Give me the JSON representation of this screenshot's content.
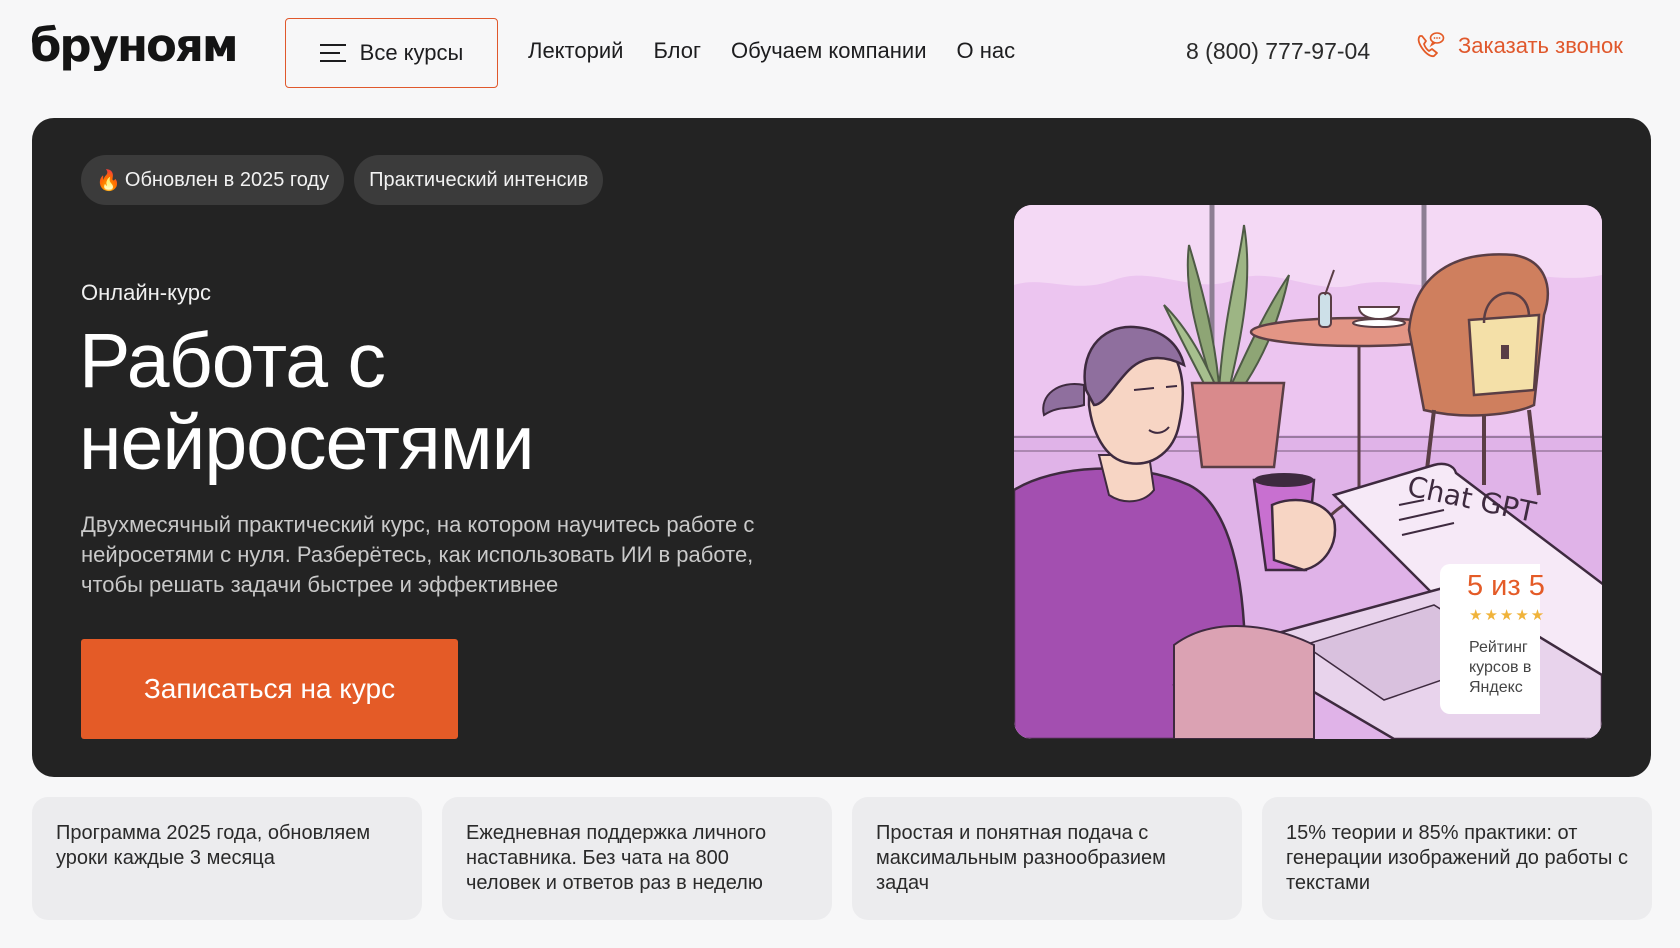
{
  "header": {
    "logo": "бруноям",
    "all_courses_label": "Все курсы",
    "nav": [
      "Лекторий",
      "Блог",
      "Обучаем компании",
      "О нас"
    ],
    "phone": "8 (800) 777-97-04",
    "callback_label": "Заказать звонок"
  },
  "hero": {
    "badges": [
      "Обновлен в 2025 году",
      "Практический интенсив"
    ],
    "kicker": "Онлайн-курс",
    "title": "Работа с нейросетями",
    "description": "Двухмесячный практический курс, на котором научитесь работе с нейросетями с нуля. Разберётесь, как использовать ИИ в работе, чтобы решать задачи быстрее и эффективнее",
    "cta_label": "Записаться на курс",
    "illustration": {
      "screen_text": "Chat GPT"
    },
    "rating": {
      "score": "5 из 5",
      "stars": "★★★★★",
      "label": "Рейтинг курсов в Яндекс"
    }
  },
  "features": [
    "Программа 2025 года, обновляем уроки каждые 3 месяца",
    "Ежедневная поддержка личного наставника. Без чата на 800 человек и ответов раз в неделю",
    "Простая и понятная подача с максимальным разнообразием задач",
    "15% теории и 85% практики: от генерации изображений до работы с текстами"
  ],
  "colors": {
    "accent": "#e45b27",
    "hero_bg": "#232323",
    "page_bg": "#f7f7f8",
    "feature_bg": "#ececee"
  }
}
